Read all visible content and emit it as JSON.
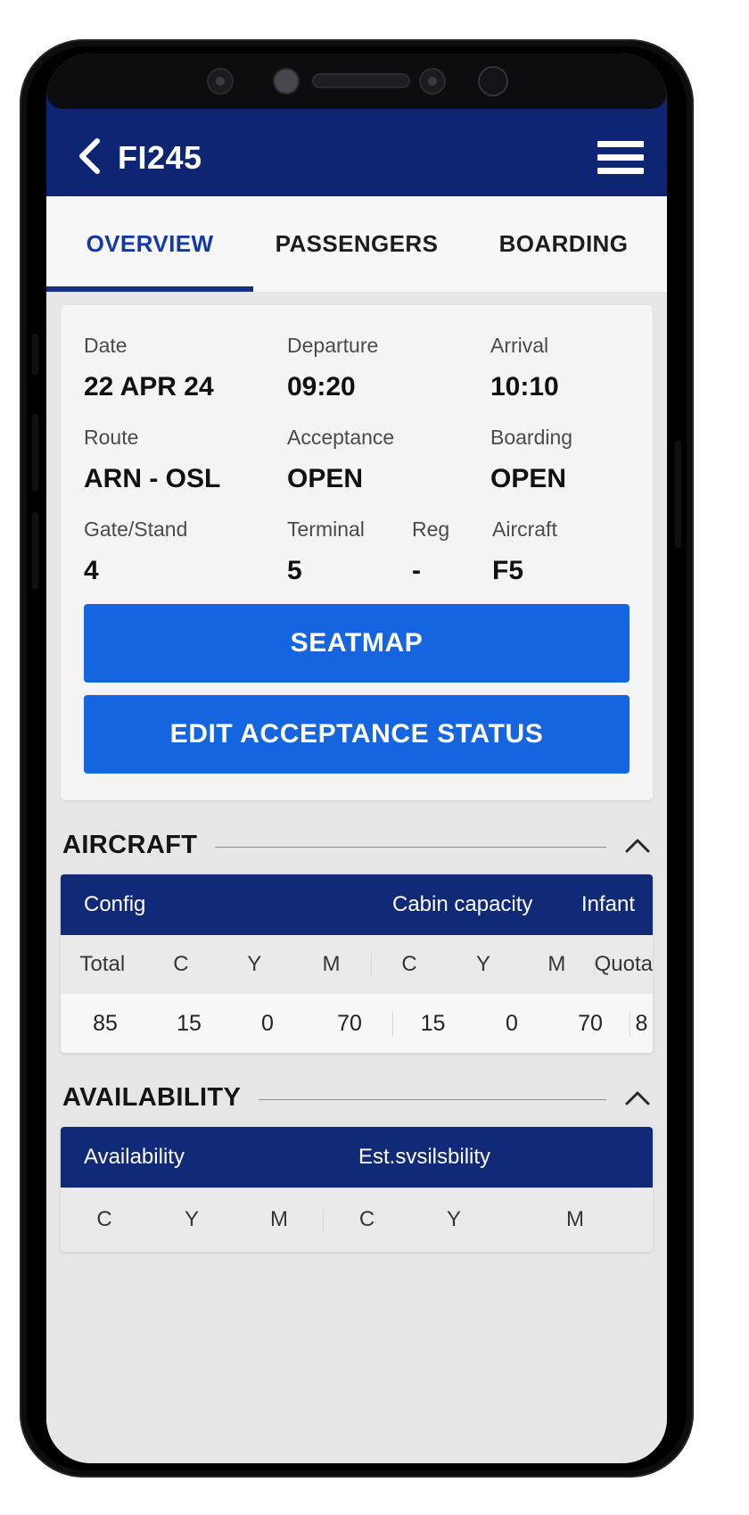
{
  "app": {
    "title": "FI245",
    "back_icon": "chevron-left-icon",
    "menu_icon": "hamburger-menu-icon",
    "header_color": "#0d2573",
    "accent_color": "#1565e0"
  },
  "tabs": [
    {
      "label": "OVERVIEW",
      "active": true
    },
    {
      "label": "PASSENGERS",
      "active": false
    },
    {
      "label": "BOARDING",
      "active": false
    }
  ],
  "overview": {
    "row1": [
      {
        "label": "Date",
        "value": "22 APR 24"
      },
      {
        "label": "Departure",
        "value": "09:20"
      },
      {
        "label": "Arrival",
        "value": "10:10"
      }
    ],
    "row2": [
      {
        "label": "Route",
        "value": "ARN - OSL"
      },
      {
        "label": "Acceptance",
        "value": "OPEN"
      },
      {
        "label": "Boarding",
        "value": "OPEN"
      }
    ],
    "row3": [
      {
        "label": "Gate/Stand",
        "value": "4"
      },
      {
        "label": "Terminal",
        "value": "5"
      },
      {
        "label": "Reg",
        "value": "-"
      },
      {
        "label": "Aircraft",
        "value": "F5"
      }
    ],
    "buttons": {
      "seatmap": "SEATMAP",
      "edit_acceptance": "EDIT ACCEPTANCE STATUS"
    }
  },
  "aircraft_section": {
    "title": "AIRCRAFT",
    "chevron_icon": "chevron-up-icon",
    "group_headers": [
      "Config",
      "Cabin capacity",
      "Infant"
    ],
    "sub_headers": [
      "Total",
      "C",
      "Y",
      "M",
      "C",
      "Y",
      "M",
      "Quota"
    ],
    "row": [
      "85",
      "15",
      "0",
      "70",
      "15",
      "0",
      "70",
      "8"
    ]
  },
  "availability_section": {
    "title": "AVAILABILITY",
    "chevron_icon": "chevron-up-icon",
    "group_headers": [
      "Availability",
      "Est.svsilsbility"
    ],
    "sub_headers": [
      "C",
      "Y",
      "M",
      "C",
      "Y",
      "M"
    ]
  }
}
